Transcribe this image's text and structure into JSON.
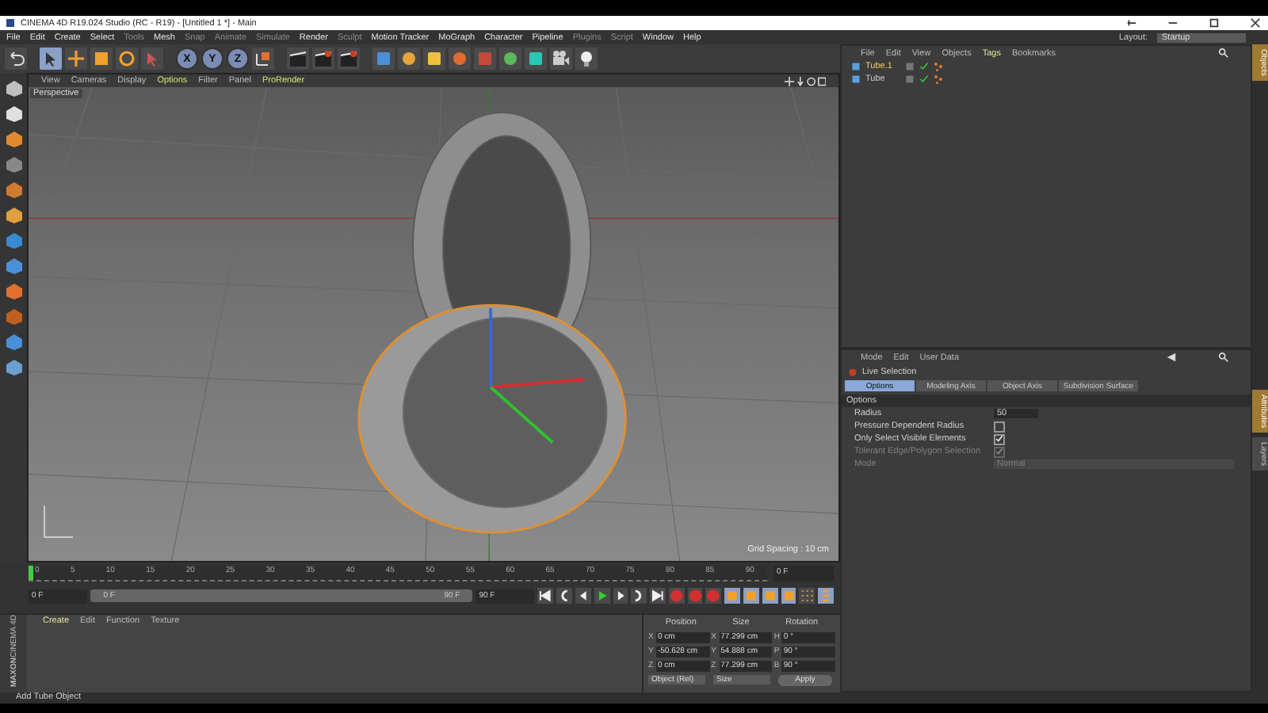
{
  "window": {
    "title": "CINEMA 4D R19.024 Studio (RC - R19) - [Untitled 1 *] - Main"
  },
  "menu_bar": [
    {
      "label": "File",
      "dimmed": false
    },
    {
      "label": "Edit",
      "dimmed": false
    },
    {
      "label": "Create",
      "dimmed": false
    },
    {
      "label": "Select",
      "dimmed": false
    },
    {
      "label": "Tools",
      "dimmed": true
    },
    {
      "label": "Mesh",
      "dimmed": false
    },
    {
      "label": "Snap",
      "dimmed": true
    },
    {
      "label": "Animate",
      "dimmed": true
    },
    {
      "label": "Simulate",
      "dimmed": true
    },
    {
      "label": "Render",
      "dimmed": false
    },
    {
      "label": "Sculpt",
      "dimmed": true
    },
    {
      "label": "Motion Tracker",
      "dimmed": false
    },
    {
      "label": "MoGraph",
      "dimmed": false
    },
    {
      "label": "Character",
      "dimmed": false
    },
    {
      "label": "Pipeline",
      "dimmed": false
    },
    {
      "label": "Plugins",
      "dimmed": true
    },
    {
      "label": "Script",
      "dimmed": true
    },
    {
      "label": "Window",
      "dimmed": false
    },
    {
      "label": "Help",
      "dimmed": false
    }
  ],
  "layout": {
    "label": "Layout:",
    "value": "Startup"
  },
  "axis_locks": [
    {
      "label": "X",
      "on": true
    },
    {
      "label": "Y",
      "on": true
    },
    {
      "label": "Z",
      "on": true
    }
  ],
  "viewport": {
    "menu": [
      {
        "label": "View",
        "highlighted": false
      },
      {
        "label": "Cameras",
        "highlighted": false
      },
      {
        "label": "Display",
        "highlighted": false
      },
      {
        "label": "Options",
        "highlighted": true
      },
      {
        "label": "Filter",
        "highlighted": false
      },
      {
        "label": "Panel",
        "highlighted": false
      },
      {
        "label": "ProRender",
        "highlighted": true
      }
    ],
    "camera": "Perspective",
    "grid_spacing": "Grid Spacing : 10 cm"
  },
  "object_manager": {
    "menu": [
      {
        "label": "File",
        "highlighted": false
      },
      {
        "label": "Edit",
        "highlighted": false
      },
      {
        "label": "View",
        "highlighted": false
      },
      {
        "label": "Objects",
        "highlighted": false
      },
      {
        "label": "Tags",
        "highlighted": true
      },
      {
        "label": "Bookmarks",
        "highlighted": false
      }
    ],
    "objects": [
      {
        "name": "Tube.1",
        "selected": true
      },
      {
        "name": "Tube",
        "selected": false
      }
    ]
  },
  "attributes": {
    "menu": [
      "Mode",
      "Edit",
      "User Data"
    ],
    "tool": "Live Selection",
    "tabs": [
      {
        "label": "Options",
        "selected": true
      },
      {
        "label": "Modeling Axis",
        "selected": false
      },
      {
        "label": "Object Axis",
        "selected": false
      },
      {
        "label": "Subdivision Surface",
        "selected": false
      }
    ],
    "section": "Options",
    "fields": [
      {
        "kind": "number",
        "label": "Radius",
        "value": "50",
        "disabled": false
      },
      {
        "kind": "checkbox",
        "label": "Pressure Dependent Radius",
        "checked": false,
        "disabled": false
      },
      {
        "kind": "checkbox",
        "label": "Only Select Visible Elements",
        "checked": true,
        "disabled": false
      },
      {
        "kind": "checkbox",
        "label": "Tolerant Edge/Polygon Selection",
        "checked": true,
        "disabled": true
      },
      {
        "kind": "dropdown",
        "label": "Mode",
        "value": "Normal",
        "disabled": true
      }
    ]
  },
  "side_tabs_top": [
    {
      "label": "Objects",
      "selected": true
    }
  ],
  "side_tabs_bottom": [
    {
      "label": "Attributes",
      "selected": true
    },
    {
      "label": "Layers",
      "selected": false
    }
  ],
  "timeline": {
    "ticks": [
      "0",
      "5",
      "10",
      "15",
      "20",
      "25",
      "30",
      "35",
      "40",
      "45",
      "50",
      "55",
      "60",
      "65",
      "70",
      "75",
      "80",
      "85",
      "90"
    ],
    "level": 0,
    "current": "0 F",
    "start": "0 F",
    "range_slider": {
      "level": 1
    },
    "range_start": "0 F",
    "range_end": "90 F",
    "end": "90 F"
  },
  "material_manager": {
    "menu": [
      {
        "label": "Create",
        "highlighted": true
      },
      {
        "label": "Edit",
        "highlighted": false
      },
      {
        "label": "Function",
        "highlighted": false
      },
      {
        "label": "Texture",
        "highlighted": false
      }
    ]
  },
  "logo": {
    "brand": "MAXON",
    "product": "CINEMA 4D"
  },
  "coordinates": {
    "headers": [
      "Position",
      "Size",
      "Rotation"
    ],
    "rows": [
      {
        "pos_axis": "X",
        "pos": "0 cm",
        "size_axis": "X",
        "size": "77.299 cm",
        "rot_axis": "H",
        "rot": "0 °"
      },
      {
        "pos_axis": "Y",
        "pos": "-50.628 cm",
        "size_axis": "Y",
        "size": "54.888 cm",
        "rot_axis": "P",
        "rot": "90 °"
      },
      {
        "pos_axis": "Z",
        "pos": "0 cm",
        "size_axis": "Z",
        "size": "77.299 cm",
        "rot_axis": "B",
        "rot": "90 °"
      }
    ],
    "mode": "Object (Rel)",
    "size_mode": "Size",
    "apply": "Apply"
  },
  "status_bar": "Add Tube Object"
}
